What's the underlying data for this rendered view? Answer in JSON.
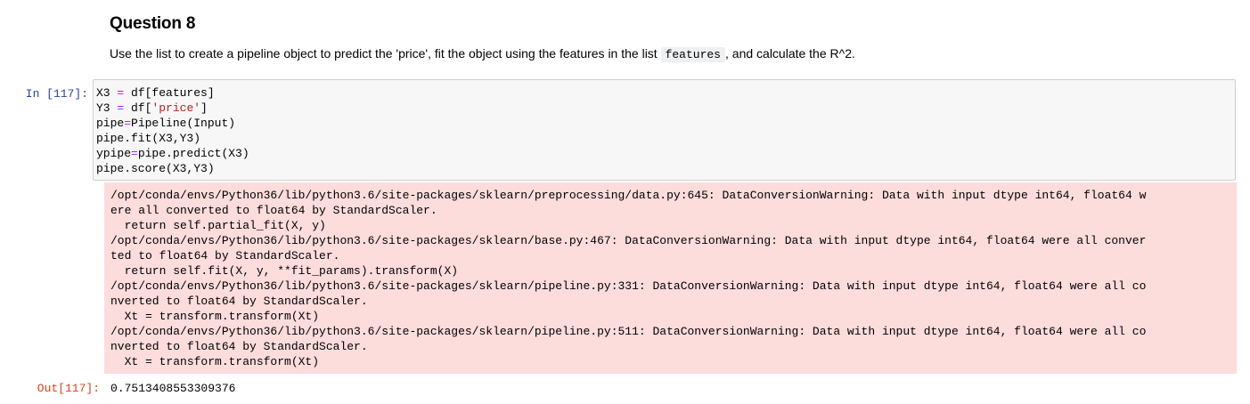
{
  "markdown": {
    "heading": "Question 8",
    "para_before": "Use the list to create a pipeline object to predict the 'price', fit the object using the features in the list ",
    "para_code": "features",
    "para_after": ", and calculate the R^2."
  },
  "code_cell": {
    "prompt": "In [117]:",
    "lines": [
      [
        {
          "t": "X3 ",
          "c": ""
        },
        {
          "t": "=",
          "c": "op"
        },
        {
          "t": " df[features]",
          "c": ""
        }
      ],
      [
        {
          "t": "Y3 ",
          "c": ""
        },
        {
          "t": "=",
          "c": "op"
        },
        {
          "t": " df[",
          "c": ""
        },
        {
          "t": "'price'",
          "c": "str"
        },
        {
          "t": "]",
          "c": ""
        }
      ],
      [
        {
          "t": "pipe",
          "c": ""
        },
        {
          "t": "=",
          "c": "op"
        },
        {
          "t": "Pipeline(Input)",
          "c": ""
        }
      ],
      [
        {
          "t": "pipe.fit(X3,Y3)",
          "c": ""
        }
      ],
      [
        {
          "t": "ypipe",
          "c": ""
        },
        {
          "t": "=",
          "c": "op"
        },
        {
          "t": "pipe.predict(X3)",
          "c": ""
        }
      ],
      [
        {
          "t": "pipe.score(X3,Y3)",
          "c": ""
        }
      ]
    ]
  },
  "stderr": {
    "lines": [
      "/opt/conda/envs/Python36/lib/python3.6/site-packages/sklearn/preprocessing/data.py:645: DataConversionWarning: Data with input dtype int64, float64 w",
      "ere all converted to float64 by StandardScaler.",
      "  return self.partial_fit(X, y)",
      "/opt/conda/envs/Python36/lib/python3.6/site-packages/sklearn/base.py:467: DataConversionWarning: Data with input dtype int64, float64 were all conver",
      "ted to float64 by StandardScaler.",
      "  return self.fit(X, y, **fit_params).transform(X)",
      "/opt/conda/envs/Python36/lib/python3.6/site-packages/sklearn/pipeline.py:331: DataConversionWarning: Data with input dtype int64, float64 were all co",
      "nverted to float64 by StandardScaler.",
      "  Xt = transform.transform(Xt)",
      "/opt/conda/envs/Python36/lib/python3.6/site-packages/sklearn/pipeline.py:511: DataConversionWarning: Data with input dtype int64, float64 were all co",
      "nverted to float64 by StandardScaler.",
      "  Xt = transform.transform(Xt)"
    ]
  },
  "output": {
    "prompt": "Out[117]:",
    "value": "0.7513408553309376"
  },
  "colors": {
    "in_prompt": "#303f9f",
    "out_prompt": "#d84315",
    "operator": "#aa22ff",
    "string": "#ba2121",
    "stderr_bg": "#fddcdc",
    "input_bg": "#f7f7f7"
  }
}
